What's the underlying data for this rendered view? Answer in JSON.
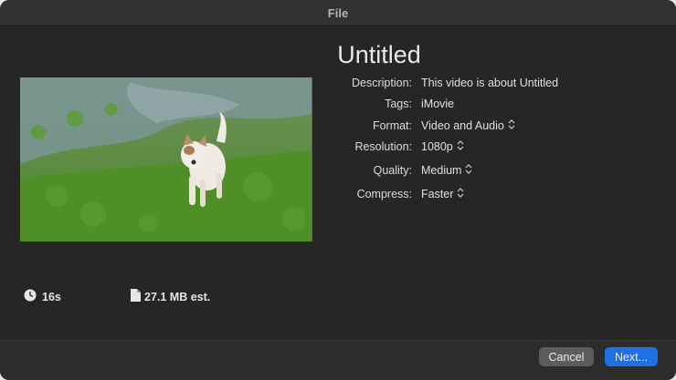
{
  "window": {
    "title": "File"
  },
  "project": {
    "title": "Untitled"
  },
  "preview": {
    "alt": "dog in a grassy field"
  },
  "fields": [
    {
      "label": "Description:",
      "value": "This video is about Untitled",
      "has_chevron": false
    },
    {
      "label": "Tags:",
      "value": "iMovie",
      "has_chevron": false
    },
    {
      "label": "Format:",
      "value": "Video and Audio",
      "has_chevron": true
    },
    {
      "label": "Resolution:",
      "value": "1080p",
      "has_chevron": true
    },
    {
      "label": "Quality:",
      "value": "Medium",
      "has_chevron": true
    },
    {
      "label": "Compress:",
      "value": "Faster",
      "has_chevron": true
    }
  ],
  "meta": {
    "duration": "16s",
    "file_size": "27.1 MB est."
  },
  "buttons": {
    "cancel": "Cancel",
    "next": "Next..."
  },
  "colors": {
    "accent": "#1f6fe5",
    "background": "#262626"
  }
}
